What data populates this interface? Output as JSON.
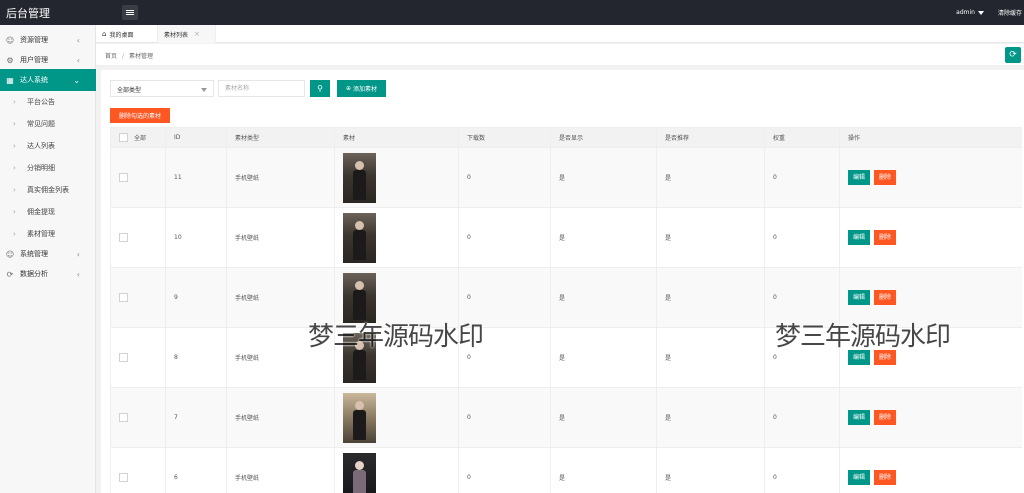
{
  "app": {
    "title": "后台管理"
  },
  "topbar": {
    "user": "admin",
    "clear_cache": "清除缓存"
  },
  "sidebar": {
    "items": [
      {
        "label": "资源管理",
        "icon": "user-icon",
        "expanded": false
      },
      {
        "label": "用户管理",
        "icon": "settings-icon",
        "expanded": false
      },
      {
        "label": "达人系统",
        "icon": "grid-icon",
        "expanded": true
      },
      {
        "label": "系统管理",
        "icon": "user-icon",
        "expanded": false
      },
      {
        "label": "数据分析",
        "icon": "refresh-icon",
        "expanded": false
      }
    ],
    "sub_items": [
      "平台公告",
      "常见问题",
      "达人列表",
      "分销明细",
      "真实佣金列表",
      "佣金提现",
      "素材管理"
    ]
  },
  "tabs": [
    {
      "label": "我的桌面",
      "icon": "home-icon"
    },
    {
      "label": "素材列表",
      "closable": true
    }
  ],
  "breadcrumb": [
    "首页",
    "素材管理"
  ],
  "toolbar": {
    "type_select_value": "全部类型",
    "name_placeholder": "素材名称",
    "add_label": "添加素材",
    "delete_selected_label": "删除勾选的素材"
  },
  "table": {
    "columns": [
      "全部",
      "ID",
      "素材类型",
      "素材",
      "下载数",
      "是否显示",
      "是否推荐",
      "权重",
      "操作"
    ],
    "rows": [
      {
        "id": "11",
        "type": "手机壁纸",
        "downloads": "0",
        "show": "是",
        "recommend": "是",
        "weight": "0"
      },
      {
        "id": "10",
        "type": "手机壁纸",
        "downloads": "0",
        "show": "是",
        "recommend": "是",
        "weight": "0"
      },
      {
        "id": "9",
        "type": "手机壁纸",
        "downloads": "0",
        "show": "是",
        "recommend": "是",
        "weight": "0"
      },
      {
        "id": "8",
        "type": "手机壁纸",
        "downloads": "0",
        "show": "是",
        "recommend": "是",
        "weight": "0"
      },
      {
        "id": "7",
        "type": "手机壁纸",
        "downloads": "0",
        "show": "是",
        "recommend": "是",
        "weight": "0"
      },
      {
        "id": "6",
        "type": "手机壁纸",
        "downloads": "0",
        "show": "是",
        "recommend": "是",
        "weight": "0"
      }
    ],
    "edit_label": "编辑",
    "delete_label": "删除"
  },
  "watermark": "梦三年源码水印",
  "colors": {
    "topbar": "#23262e",
    "primary": "#009688",
    "danger": "#ff5722"
  }
}
